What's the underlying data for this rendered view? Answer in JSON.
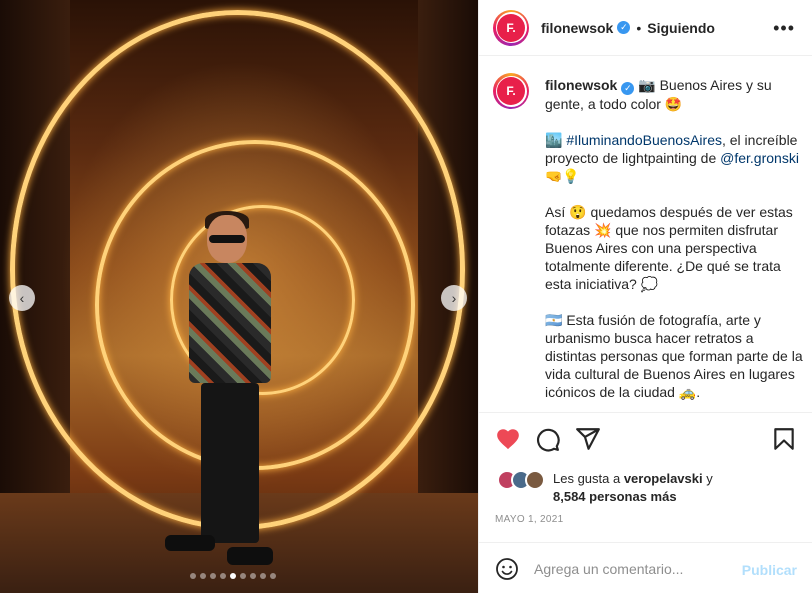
{
  "post": {
    "username": "filonewsok",
    "follow_label": "Siguiendo",
    "separator": "•",
    "avatar_letter": "F.",
    "more_label": "•••"
  },
  "caption": {
    "username": "filonewsok",
    "line1": "📷 Buenos Aires y su gente, a todo color 🤩",
    "p2_prefix": "🏙️ ",
    "p2_hashtag": "#IluminandoBuenosAires",
    "p2_middle": ", el increíble proyecto de lightpainting de ",
    "p2_mention": "@fer.gronski",
    "p2_suffix": " 🤜💡",
    "p3": "Así 😲 quedamos después de ver estas fotazas 💥 que nos permiten disfrutar Buenos Aires con una perspectiva totalmente diferente. ¿De qué se trata esta iniciativa? 💭",
    "p4": "🇦🇷 Esta fusión de fotografía, arte y urbanismo busca hacer retratos a distintas personas que forman parte de la vida cultural de Buenos Aires en lugares icónicos de la ciudad 🚕."
  },
  "likes": {
    "prefix": "Les gusta a ",
    "user": "veropelavski",
    "middle": " y",
    "count": "8,584 personas más"
  },
  "date": "MAYO 1, 2021",
  "comment": {
    "placeholder": "Agrega un comentario...",
    "publish_label": "Publicar"
  },
  "carousel": {
    "prev_icon": "‹",
    "next_icon": "›",
    "total": 9,
    "active_index": 4
  },
  "colors": {
    "like_red": "#ed4956",
    "verified_blue": "#3897f0",
    "publish_disabled": "#b2dffc",
    "brand_red": "#e8204a"
  },
  "icons": [
    "heart-icon",
    "comment-icon",
    "share-icon",
    "bookmark-icon",
    "emoji-icon",
    "verified-icon",
    "chevron-left-icon",
    "chevron-right-icon"
  ]
}
